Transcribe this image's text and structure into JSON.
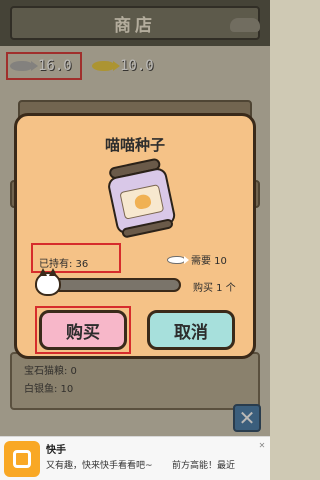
{
  "header": {
    "title": "商店"
  },
  "currency": {
    "silver": "16.0",
    "gold": "10.0"
  },
  "background": {
    "lines": [
      "宝石猫粮: 0",
      "白银鱼: 10"
    ]
  },
  "dialog": {
    "title": "喵喵种子",
    "owned_label": "已持有: 36",
    "need_label": "需要 10",
    "buy_count_label": "购买 1 个",
    "buy_button": "购买",
    "cancel_button": "取消"
  },
  "close_button": "✕",
  "ad": {
    "name": "快手",
    "description": "又有趣，快来快手看看吧~",
    "cta": "前方高能！最近",
    "close": "✕"
  },
  "colors": {
    "dialog_bg": "#f5c287",
    "buy_button": "#f7b7c9",
    "cancel_button": "#a7e0dc",
    "highlight": "#d62c2c"
  }
}
